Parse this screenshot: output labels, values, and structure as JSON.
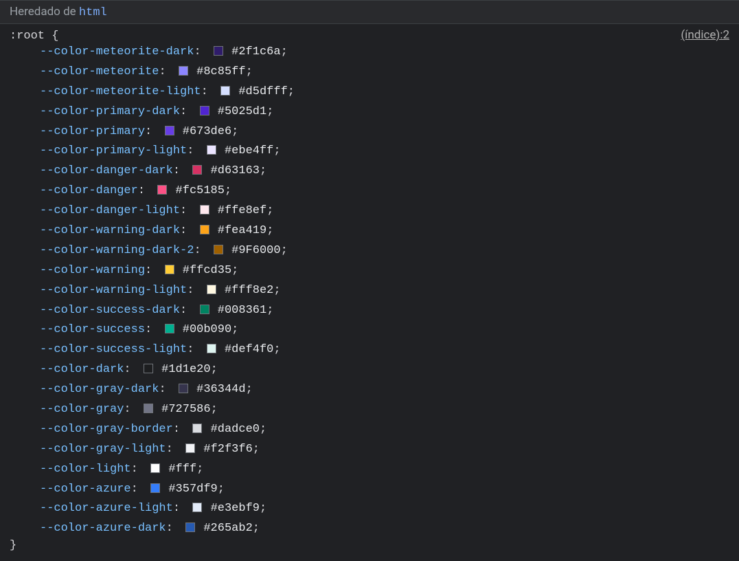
{
  "header": {
    "inherited_label": "Heredado de ",
    "inherited_from": "html"
  },
  "rule": {
    "selector": ":root",
    "brace_open": "{",
    "brace_close": "}",
    "source_link": "(índice):2"
  },
  "declarations": [
    {
      "name": "--color-meteorite-dark",
      "value": "#2f1c6a",
      "swatch": "#2f1c6a"
    },
    {
      "name": "--color-meteorite",
      "value": "#8c85ff",
      "swatch": "#8c85ff"
    },
    {
      "name": "--color-meteorite-light",
      "value": "#d5dfff",
      "swatch": "#d5dfff"
    },
    {
      "name": "--color-primary-dark",
      "value": "#5025d1",
      "swatch": "#5025d1"
    },
    {
      "name": "--color-primary",
      "value": "#673de6",
      "swatch": "#673de6"
    },
    {
      "name": "--color-primary-light",
      "value": "#ebe4ff",
      "swatch": "#ebe4ff"
    },
    {
      "name": "--color-danger-dark",
      "value": "#d63163",
      "swatch": "#d63163"
    },
    {
      "name": "--color-danger",
      "value": "#fc5185",
      "swatch": "#fc5185"
    },
    {
      "name": "--color-danger-light",
      "value": "#ffe8ef",
      "swatch": "#ffe8ef"
    },
    {
      "name": "--color-warning-dark",
      "value": "#fea419",
      "swatch": "#fea419"
    },
    {
      "name": "--color-warning-dark-2",
      "value": "#9F6000",
      "swatch": "#9F6000"
    },
    {
      "name": "--color-warning",
      "value": "#ffcd35",
      "swatch": "#ffcd35"
    },
    {
      "name": "--color-warning-light",
      "value": "#fff8e2",
      "swatch": "#fff8e2"
    },
    {
      "name": "--color-success-dark",
      "value": "#008361",
      "swatch": "#008361"
    },
    {
      "name": "--color-success",
      "value": "#00b090",
      "swatch": "#00b090"
    },
    {
      "name": "--color-success-light",
      "value": "#def4f0",
      "swatch": "#def4f0"
    },
    {
      "name": "--color-dark",
      "value": "#1d1e20",
      "swatch": "#1d1e20"
    },
    {
      "name": "--color-gray-dark",
      "value": "#36344d",
      "swatch": "#36344d"
    },
    {
      "name": "--color-gray",
      "value": "#727586",
      "swatch": "#727586"
    },
    {
      "name": "--color-gray-border",
      "value": "#dadce0",
      "swatch": "#dadce0"
    },
    {
      "name": "--color-gray-light",
      "value": "#f2f3f6",
      "swatch": "#f2f3f6"
    },
    {
      "name": "--color-light",
      "value": "#fff",
      "swatch": "#ffffff"
    },
    {
      "name": "--color-azure",
      "value": "#357df9",
      "swatch": "#357df9"
    },
    {
      "name": "--color-azure-light",
      "value": "#e3ebf9",
      "swatch": "#e3ebf9"
    },
    {
      "name": "--color-azure-dark",
      "value": "#265ab2",
      "swatch": "#265ab2"
    }
  ]
}
